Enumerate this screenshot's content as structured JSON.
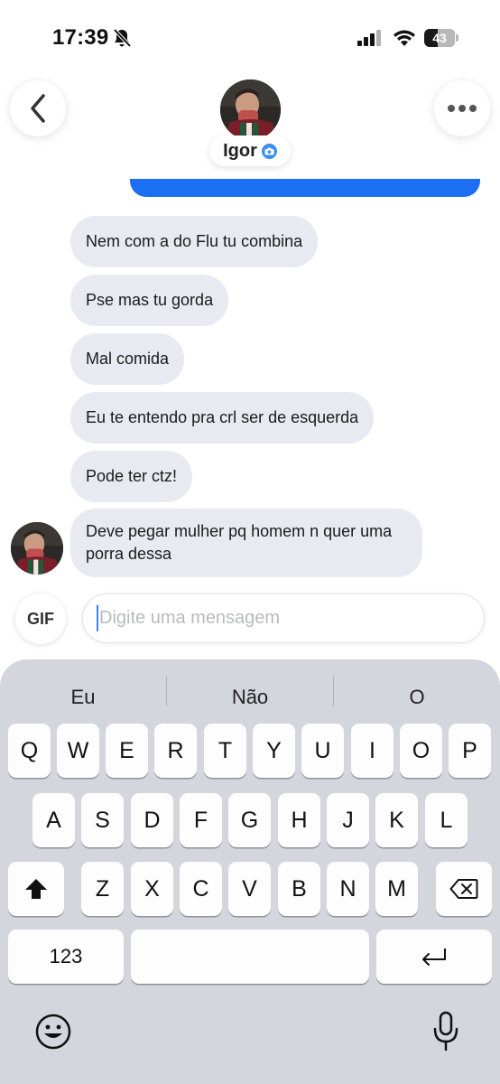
{
  "status_bar": {
    "time": "17:39",
    "battery_percent": "43",
    "battery_level": 0.43,
    "icons": [
      "bell-slash-icon",
      "cellular-signal-icon",
      "wifi-icon",
      "battery-icon"
    ]
  },
  "header": {
    "contact_name": "Igor",
    "verified_badge": "camera-badge-icon",
    "back_icon": "chevron-left-icon",
    "more_icon": "ellipsis-icon"
  },
  "chat": {
    "incoming_messages": [
      {
        "text": "Nem com a do Flu tu combina"
      },
      {
        "text": "Pse mas tu gorda"
      },
      {
        "text": "Mal comida"
      },
      {
        "text": "Eu te entendo pra crl ser de esquerda"
      },
      {
        "text": "Pode ter ctz!"
      },
      {
        "text": "Deve pegar mulher pq homem n quer uma porra dessa"
      }
    ],
    "sent_bubble_color": "#1c6ef2",
    "incoming_bubble_color": "#e9eaf1"
  },
  "composer": {
    "gif_label": "GIF",
    "placeholder": "Digite uma mensagem",
    "value": ""
  },
  "keyboard": {
    "suggestions": [
      "Eu",
      "Não",
      "O"
    ],
    "row1": [
      "Q",
      "W",
      "E",
      "R",
      "T",
      "Y",
      "U",
      "I",
      "O",
      "P"
    ],
    "row2": [
      "A",
      "S",
      "D",
      "F",
      "G",
      "H",
      "J",
      "K",
      "L"
    ],
    "row3": [
      "Z",
      "X",
      "C",
      "V",
      "B",
      "N",
      "M"
    ],
    "numbers_label": "123",
    "space_label": "",
    "icons": [
      "shift-icon",
      "backspace-icon",
      "return-icon",
      "emoji-icon",
      "microphone-icon"
    ]
  }
}
